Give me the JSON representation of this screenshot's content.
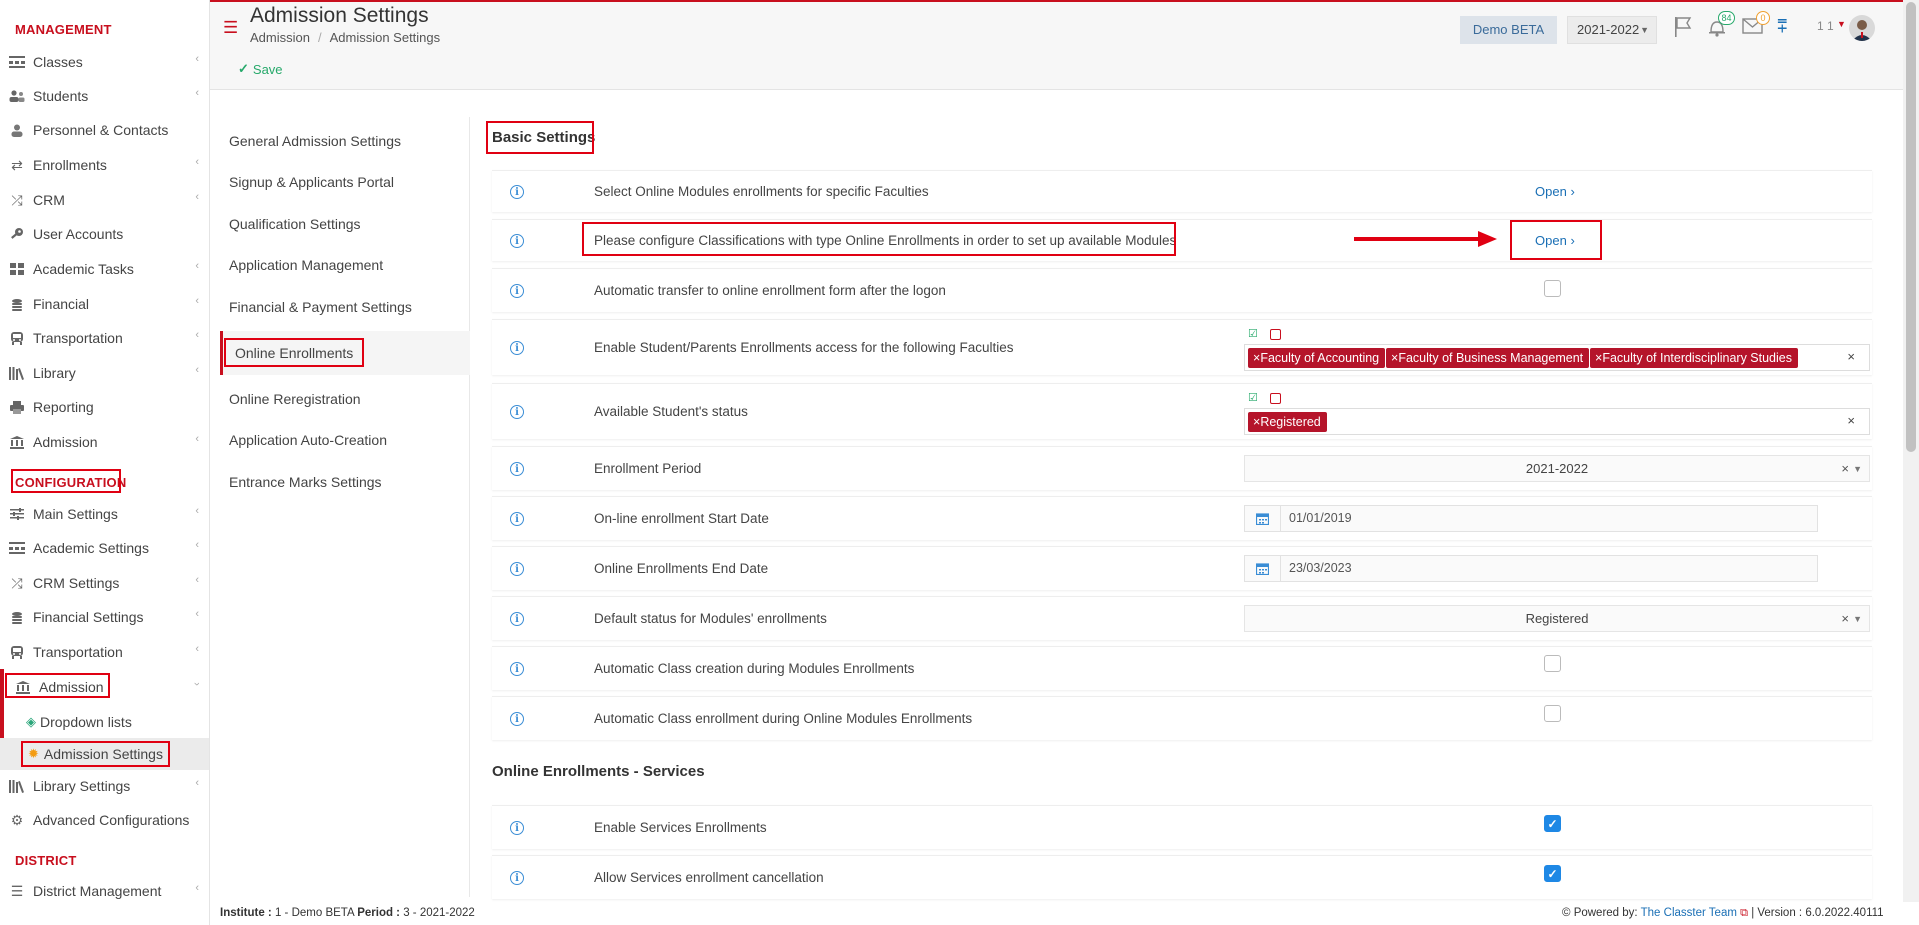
{
  "sidebar": {
    "management_title": "MANAGEMENT",
    "management_items": [
      {
        "label": "Classes",
        "icon": "classes-icon"
      },
      {
        "label": "Students",
        "icon": "students-icon"
      },
      {
        "label": "Personnel & Contacts",
        "icon": "personnel-icon"
      },
      {
        "label": "Enrollments",
        "icon": "enrollments-icon"
      },
      {
        "label": "CRM",
        "icon": "crm-icon"
      },
      {
        "label": "User Accounts",
        "icon": "key-icon"
      },
      {
        "label": "Academic Tasks",
        "icon": "tasks-icon"
      },
      {
        "label": "Financial",
        "icon": "coins-icon"
      },
      {
        "label": "Transportation",
        "icon": "bus-icon"
      },
      {
        "label": "Library",
        "icon": "library-icon"
      },
      {
        "label": "Reporting",
        "icon": "print-icon"
      },
      {
        "label": "Admission",
        "icon": "institution-icon"
      }
    ],
    "configuration_title": "CONFIGURATION",
    "configuration_items": [
      {
        "label": "Main Settings",
        "icon": "sliders-icon"
      },
      {
        "label": "Academic Settings",
        "icon": "classes-icon"
      },
      {
        "label": "CRM Settings",
        "icon": "crm-icon"
      },
      {
        "label": "Financial Settings",
        "icon": "coins-icon"
      },
      {
        "label": "Transportation",
        "icon": "bus-icon"
      },
      {
        "label": "Admission",
        "icon": "institution-icon"
      }
    ],
    "admission_subitems": [
      {
        "label": "Dropdown lists",
        "icon": "layers-icon"
      },
      {
        "label": "Admission Settings",
        "icon": "gear-icon"
      }
    ],
    "configuration_items_after": [
      {
        "label": "Library Settings",
        "icon": "library-icon"
      },
      {
        "label": "Advanced Configurations",
        "icon": "gears-icon"
      }
    ],
    "district_title": "DISTRICT",
    "district_items": [
      {
        "label": "District Management",
        "icon": "menu-icon"
      }
    ]
  },
  "header": {
    "title": "Admission Settings",
    "breadcrumb": [
      "Admission",
      "/",
      "Admission Settings"
    ],
    "institute_button": "Demo BETA",
    "period_select": "2021-2022",
    "notifications_count": "84",
    "messages_count": "0",
    "user_label": "1 1"
  },
  "toolbar": {
    "save_label": "Save"
  },
  "subnav": {
    "items": [
      "General Admission Settings",
      "Signup & Applicants Portal",
      "Qualification Settings",
      "Application Management",
      "Financial & Payment Settings",
      "Online Enrollments",
      "Online Reregistration",
      "Application Auto-Creation",
      "Entrance Marks Settings"
    ],
    "active": "Online Enrollments"
  },
  "basic_settings": {
    "title": "Basic Settings",
    "info_glyph": "i",
    "open_label": "Open",
    "rows": [
      "Select Online Modules enrollments for specific Faculties",
      "Please configure Classifications with type Online Enrollments in order to set up available Modules",
      "Automatic transfer to online enrollment form after the logon",
      "Enable Student/Parents Enrollments access for the following Faculties",
      "Available Student's status",
      "Enrollment Period",
      "On-line enrollment Start Date",
      "Online Enrollments End Date",
      "Default status for Modules' enrollments",
      "Automatic Class creation during Modules Enrollments",
      "Automatic Class enrollment during Online Modules Enrollments"
    ],
    "faculties_tags": [
      "Faculty of Accounting",
      "Faculty of Business Management",
      "Faculty of Interdisciplinary Studies"
    ],
    "status_tags": [
      "Registered"
    ],
    "tag_remove_glyph": "×",
    "clear_glyph": "×",
    "enrollment_period_value": "2021-2022",
    "start_date_value": "01/01/2019",
    "end_date_value": "23/03/2023",
    "default_status_value": "Registered",
    "checkbox_states": {
      "automatic_transfer": false,
      "class_creation": false,
      "class_enrollment": false
    }
  },
  "services": {
    "title": "Online Enrollments - Services",
    "rows": [
      "Enable Services Enrollments",
      "Allow Services enrollment cancellation"
    ],
    "checkbox_states": {
      "enable_services": true,
      "allow_cancellation": true
    }
  },
  "footer": {
    "institute_label": "Institute :",
    "institute_value": "1 - Demo BETA",
    "period_label": "Period :",
    "period_value": "3 - 2021-2022",
    "powered_by": "Powered by:",
    "powered_team": "The Classter Team",
    "version": "| Version : 6.0.2022.40111"
  },
  "colors": {
    "brand_red": "#c80f1e",
    "highlight_red": "#e00012",
    "link_blue": "#1a6fb5",
    "checkbox_blue": "#1e88e5",
    "tag_red": "#b5142a"
  }
}
